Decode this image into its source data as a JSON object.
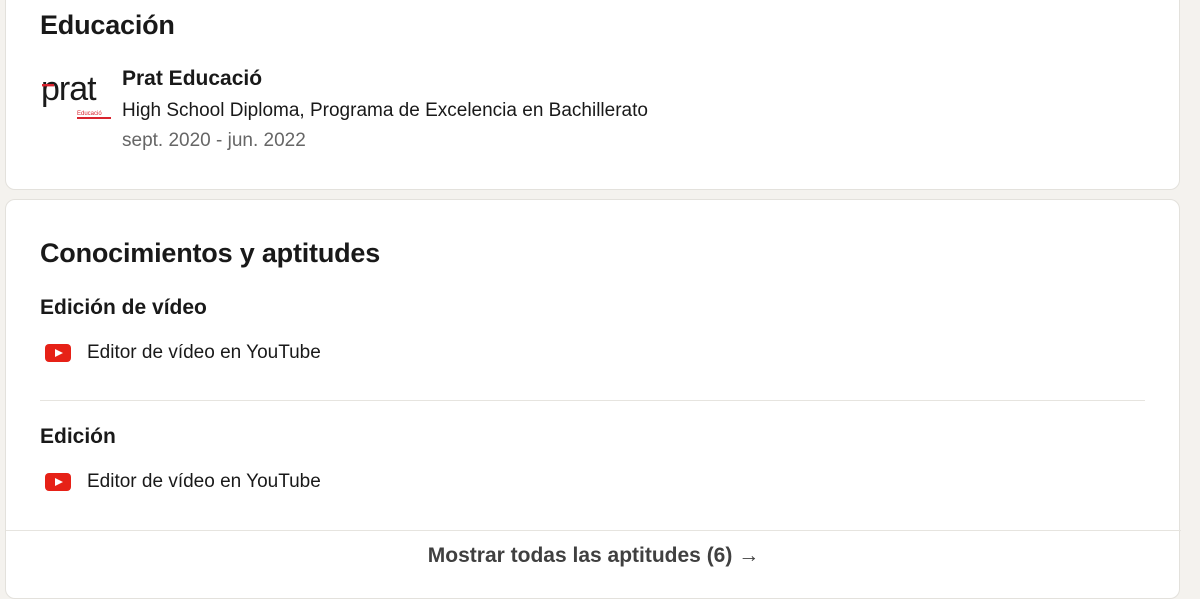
{
  "education": {
    "title": "Educación",
    "entries": [
      {
        "logo_text": "prat",
        "logo_sub": "Educació",
        "school": "Prat Educació",
        "degree": "High School Diploma, Programa de Excelencia en Bachillerato",
        "dates": "sept. 2020 - jun. 2022"
      }
    ]
  },
  "skills": {
    "title": "Conocimientos y aptitudes",
    "items": [
      {
        "name": "Edición de vídeo",
        "source_icon": "youtube-icon",
        "source": "Editor de vídeo en YouTube"
      },
      {
        "name": "Edición",
        "source_icon": "youtube-icon",
        "source": "Editor de vídeo en YouTube"
      }
    ],
    "show_all_label": "Mostrar todas las aptitudes (6) →"
  },
  "colors": {
    "youtube_red": "#e62117",
    "logo_red": "#d9232e"
  }
}
